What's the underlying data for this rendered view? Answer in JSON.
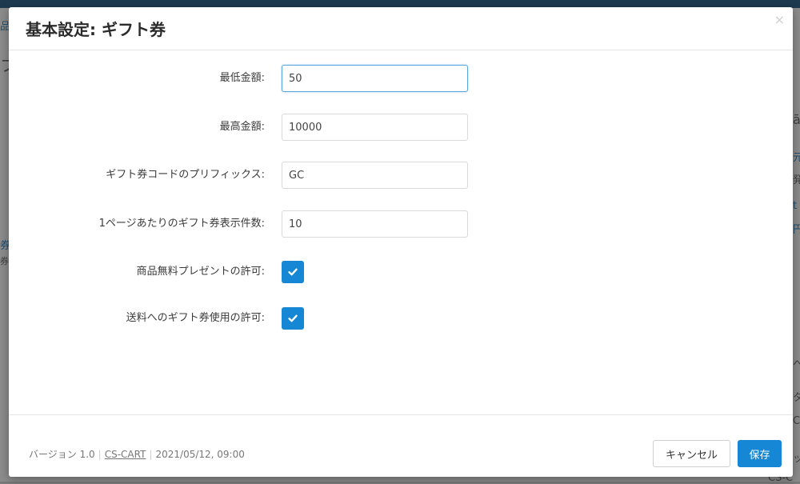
{
  "modal": {
    "title": "基本設定: ギフト券",
    "close_glyph": "×"
  },
  "fields": {
    "min_amount": {
      "label": "最低金額:",
      "value": "50"
    },
    "max_amount": {
      "label": "最高金額:",
      "value": "10000"
    },
    "code_prefix": {
      "label": "ギフト券コードのプリフィックス:",
      "value": "GC"
    },
    "per_page": {
      "label": "1ページあたりのギフト券表示件数:",
      "value": "10"
    },
    "free_products": {
      "label": "商品無料プレゼントの許可:",
      "checked": true
    },
    "shipping_use": {
      "label": "送料へのギフト券使用の許可:",
      "checked": true
    }
  },
  "footer": {
    "version": "バージョン 1.0",
    "vendor_link": "CS-CART",
    "date": "2021/05/12, 09:00",
    "separator": "|",
    "cancel_label": "キャンセル",
    "save_label": "保存"
  },
  "background_fragments": {
    "top_left": "品",
    "title_fragment": "フ",
    "left_link_1": "券",
    "left_text_2": "券",
    "right_1": "ā",
    "right_2": "元",
    "right_3": "発",
    "right_4": "t",
    "right_5": "円",
    "right_6": "へ",
    "right_7": "タ",
    "right_8": "C",
    "right_9": "ッ",
    "bottom_right": "CS-C"
  },
  "colors": {
    "accent": "#1587d4",
    "focus_border": "#58a6dd",
    "topbar": "#1d3a4f"
  },
  "icons": {
    "checkbox": "check-icon",
    "close": "close-icon"
  }
}
